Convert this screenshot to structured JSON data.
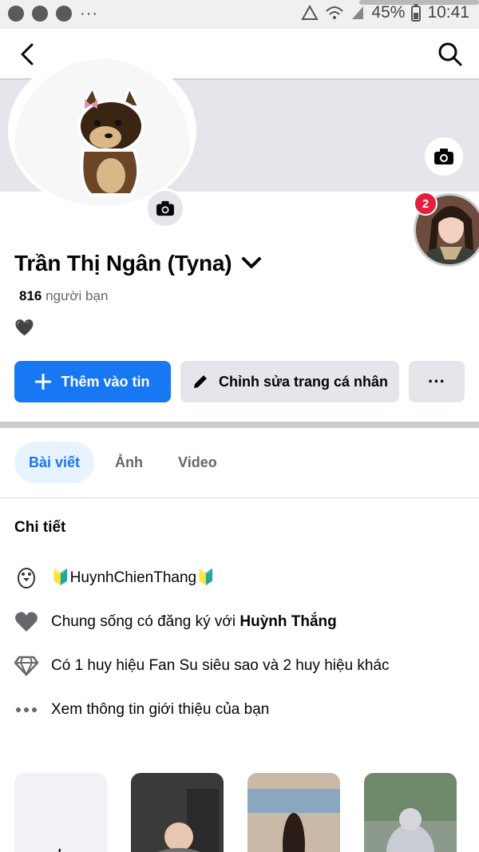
{
  "status_bar": {
    "battery": "45%",
    "time": "10:41",
    "dots": "···"
  },
  "profile": {
    "name": "Trần Thị Ngân (Tyna)",
    "friends_count": "816",
    "friends_label": "người bạn",
    "bio": "🖤",
    "story_badge": "2"
  },
  "actions": {
    "add_story": "Thêm vào tin",
    "edit_profile": "Chỉnh sửa trang cá nhân",
    "more": "···"
  },
  "tabs": [
    {
      "label": "Bài viết"
    },
    {
      "label": "Ảnh"
    },
    {
      "label": "Video"
    }
  ],
  "details": {
    "title": "Chi tiết",
    "items": [
      {
        "icon": "penguin-icon",
        "prefix": "🔰HuynhChienThang🔰",
        "text": "",
        "bold": ""
      },
      {
        "icon": "heart-icon",
        "text": "Chung sống có đăng ký với ",
        "bold": "Huỳnh Thắng"
      },
      {
        "icon": "diamond-icon",
        "text": "Có 1 huy hiệu Fan Su siêu sao và 2 huy hiệu khác",
        "bold": ""
      },
      {
        "icon": "more-dots-icon",
        "text": "Xem thông tin giới thiệu của bạn",
        "bold": ""
      }
    ]
  },
  "colors": {
    "primary": "#1877f2",
    "badge": "#e41e3f",
    "surface": "#e4e6eb"
  }
}
